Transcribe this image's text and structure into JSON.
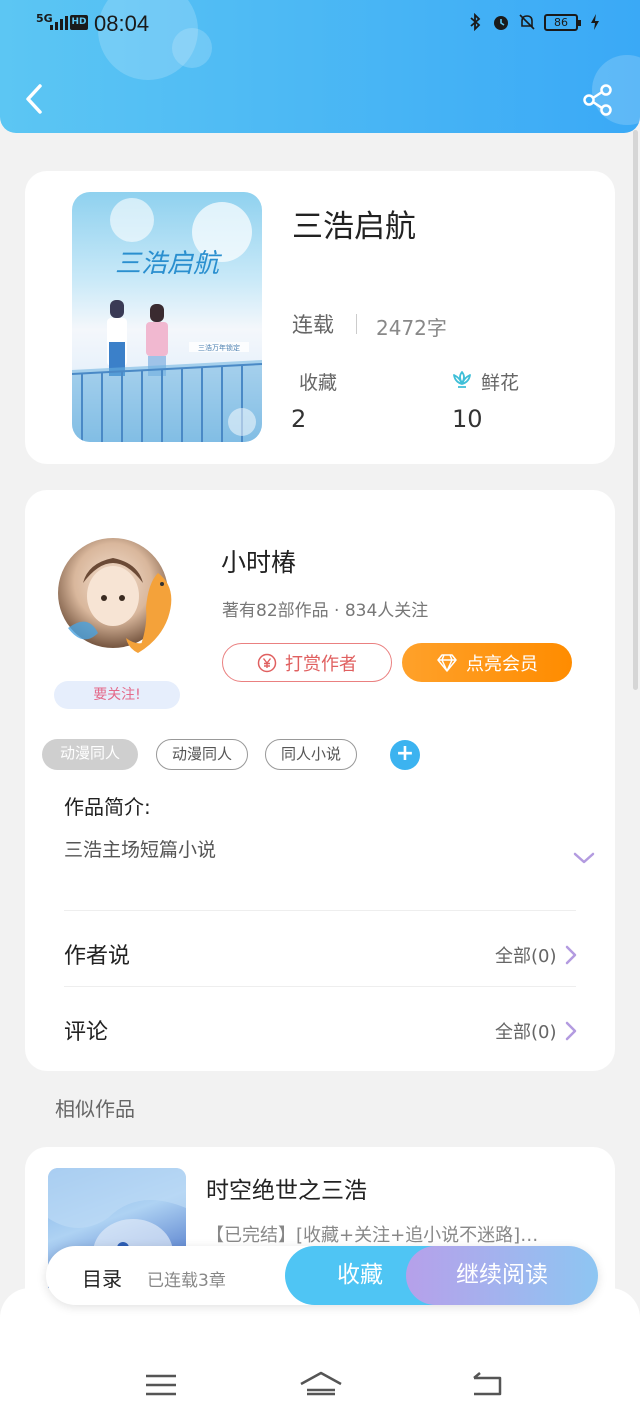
{
  "status_bar": {
    "network": "5G",
    "hd": "HD",
    "time": "08:04",
    "battery": "86"
  },
  "header": {
    "back_icon": "chevron-left-icon",
    "share_icon": "share-icon"
  },
  "book": {
    "title": "三浩启航",
    "status": "连载",
    "words": "2472字",
    "stats": {
      "favorites_label": "收藏",
      "favorites_value": "2",
      "flowers_label": "鲜花",
      "flowers_value": "10"
    },
    "cover_title_art": "三浩启航",
    "cover_caption": "三浩万年锁定"
  },
  "author": {
    "name": "小时椿",
    "info": "著有82部作品 · 834人关注",
    "follow_tag": "要关注!",
    "reward_label": "打赏作者",
    "vip_label": "点亮会员",
    "tags": [
      "动漫同人",
      "动漫同人",
      "同人小说"
    ],
    "add_tag": "+",
    "intro_label": "作品简介:",
    "intro_text": "三浩主场短篇小说",
    "author_say_label": "作者说",
    "author_say_link": "全部(0)",
    "comments_label": "评论",
    "comments_link": "全部(0)"
  },
  "similar": {
    "section_title": "相似作品",
    "items": [
      {
        "title": "时空绝世之三浩",
        "desc": "【已完结】[收藏+关注+追小说不迷路]…"
      }
    ]
  },
  "bottom_bar": {
    "toc_label": "目录",
    "toc_count": "已连载3章",
    "collect_label": "收藏",
    "read_label": "继续阅读"
  },
  "colors": {
    "header_start": "#5cc6f3",
    "header_end": "#3aa9f6",
    "vip_orange": "#ff9a1a",
    "reward_red": "#e06060",
    "accent_blue": "#3cb3f0"
  }
}
